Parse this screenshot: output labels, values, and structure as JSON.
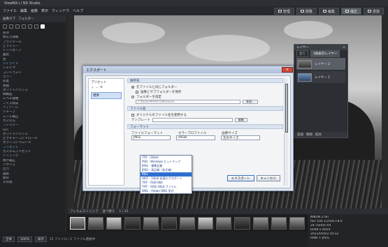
{
  "titlebar": {
    "title": "ViewNX-i  /  NX Studio"
  },
  "menubar": {
    "items": [
      "ファイル",
      "編集",
      "画像",
      "表示",
      "ウィンドウ",
      "ヘルプ"
    ]
  },
  "modes": [
    {
      "label": "管理"
    },
    {
      "label": "閲覧"
    },
    {
      "label": "編集"
    },
    {
      "label": "補正"
    },
    {
      "label": "変換"
    }
  ],
  "left_panel": {
    "tabs": [
      "画像タブ",
      "フォルダー"
    ],
    "items": [
      {
        "label": "最適",
        "kind": "sec"
      },
      {
        "label": "明るさ調整",
        "kind": ""
      },
      {
        "label": "ブラシツール",
        "kind": ""
      },
      {
        "label": "ピクチャー",
        "kind": "sec"
      },
      {
        "label": "トーンカーブ",
        "kind": ""
      },
      {
        "label": "露出",
        "kind": ""
      },
      {
        "label": "色",
        "kind": ""
      },
      {
        "label": "ハイライト",
        "kind": "blue"
      },
      {
        "label": "シャドウ",
        "kind": ""
      },
      {
        "label": "コントラスト",
        "kind": ""
      },
      {
        "label": "カラー",
        "kind": "sec"
      },
      {
        "label": "彩度",
        "kind": ""
      },
      {
        "label": "色相",
        "kind": ""
      },
      {
        "label": "ホワイトバランス",
        "kind": ""
      },
      {
        "label": "明瞭度",
        "kind": ""
      },
      {
        "label": "レベル調整",
        "kind": ""
      },
      {
        "label": "ノイズ除去",
        "kind": ""
      },
      {
        "label": "ディテール",
        "kind": "sec"
      },
      {
        "label": "シャープ",
        "kind": ""
      },
      {
        "label": "レンズ補正",
        "kind": ""
      },
      {
        "label": "カスタム",
        "kind": ""
      },
      {
        "label": "フィルター",
        "kind": "sec"
      },
      {
        "label": "LUT",
        "kind": ""
      },
      {
        "label": "ホワイトバランス",
        "kind": ""
      },
      {
        "label": "ピクチャーコントロール",
        "kind": ""
      },
      {
        "label": "カラーコントロール",
        "kind": ""
      },
      {
        "label": "プリセット",
        "kind": "blue"
      },
      {
        "label": "カスタムプリセット",
        "kind": ""
      },
      {
        "label": "トリミング",
        "kind": "sec"
      },
      {
        "label": "傾き補正",
        "kind": ""
      },
      {
        "label": "リサイズ",
        "kind": ""
      },
      {
        "label": "出力",
        "kind": "sec"
      },
      {
        "label": "画質",
        "kind": ""
      },
      {
        "label": "保存",
        "kind": ""
      },
      {
        "label": "その他",
        "kind": ""
      }
    ]
  },
  "layers_panel": {
    "title": "レイヤー",
    "tabs": [
      "全て",
      "1枚表示レイヤー"
    ],
    "layers": [
      {
        "name": "レイヤー 2",
        "selected": true,
        "thumb": ""
      },
      {
        "name": "レイヤー 1",
        "selected": false,
        "thumb": "blue"
      }
    ],
    "footer": [
      "追加",
      "削除",
      "結合"
    ]
  },
  "dialog": {
    "title": "エクスポート",
    "close_label": "×",
    "preset_label": "プリセット",
    "preset_item": "標準",
    "section_output": "保存先",
    "dest_option_1": "元ファイルと同じフォルダー",
    "dest_option_1_sub": "画像とサブフォルダーを保存",
    "dest_option_2": "フォルダーを指定",
    "dest_path": "C:¥Users¥PHOTO¥Pictures",
    "browse_label": "参照...",
    "section_name": "ファイル名",
    "rename_label": "オリジナルのファイル名を使用する",
    "name_template_label": "テンプレート",
    "name_template_value": "",
    "name_button": "編集",
    "section_format": "フォーマット",
    "format_label": "ファイルフォーマット",
    "format_value": "JPEG",
    "quality_label": "カラープロファイル",
    "quality_value": "sRGB",
    "size_label": "画像サイズ",
    "size_value": "元のサイズ",
    "dropdown_items": [
      "TIFF（16bit）",
      "PSD - Windows ビットマップ",
      "JPEG - 標準品質",
      "JPEG - 高品質（非圧縮）",
      "PNG",
      "HEIF - 10bit/ 拡張エクスポート",
      "TIFF - RGB 8bit",
      "TIFF - RGB 16bit ファイル",
      "DNG - Adobe DNG 形式"
    ],
    "dropdown_selected_index": 4,
    "ok_label": "エクスポート",
    "cancel_label": "キャンセル"
  },
  "filmstrip": {
    "header": [
      "フィルムストリップ",
      "並べ替え",
      "1 / 15"
    ],
    "thumbs": [
      "sel",
      "",
      "light",
      "dark",
      "",
      "dark",
      "",
      "light",
      "",
      "dark",
      "",
      "",
      ""
    ]
  },
  "info": {
    "lines": [
      "NIKON Z 6II",
      "ISO 100  1/250s  F8.0",
      "24-70mm  f/4",
      "6048 x 4024",
      "2021/05/03  10:12",
      "RAW + JPEG"
    ]
  },
  "status": {
    "buttons": [
      "全体",
      "100%",
      "表示"
    ],
    "text": "15 ファイル / 1 ファイル選択中"
  }
}
